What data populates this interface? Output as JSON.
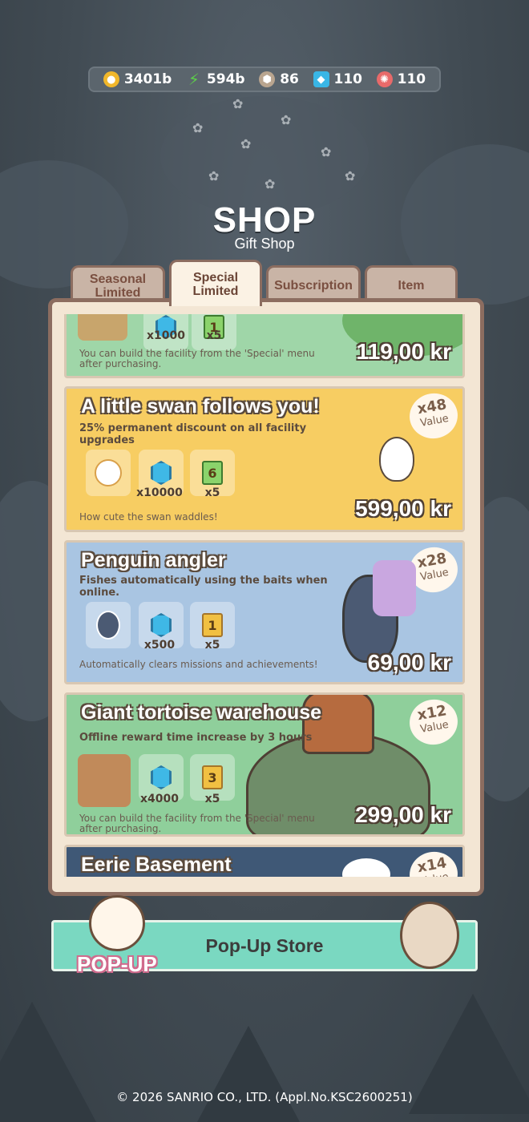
{
  "resources": [
    {
      "icon": "gold-coin-icon",
      "value": "3401b",
      "color": "#f1b72a"
    },
    {
      "icon": "energy-bolt-icon",
      "value": "594b",
      "color": "#5ccf4a"
    },
    {
      "icon": "nut-bolt-icon",
      "value": "86",
      "color": "#b9a58f"
    },
    {
      "icon": "blue-gem-icon",
      "value": "110",
      "color": "#39b6e6"
    },
    {
      "icon": "red-gem-icon",
      "value": "110",
      "color": "#e86a6a"
    }
  ],
  "header": {
    "title": "SHOP",
    "subtitle": "Gift Shop"
  },
  "tabs": [
    {
      "label": "Seasonal Limited"
    },
    {
      "label": "Special Limited"
    },
    {
      "label": "Subscription"
    },
    {
      "label": "Item"
    }
  ],
  "packages": [
    {
      "name": "",
      "description": "",
      "items": [
        {
          "qty": "x1000"
        },
        {
          "qty": "x5"
        }
      ],
      "footer": "You can build the facility from the 'Special' menu after purchasing.",
      "price": "119,00 kr",
      "bg": "#9fd6a8"
    },
    {
      "name": "A little swan follows you!",
      "description": "25% permanent discount on all facility upgrades",
      "items": [
        {
          "qty": ""
        },
        {
          "qty": "x10000"
        },
        {
          "qty": "x5",
          "ticket": "6"
        }
      ],
      "footer": "How cute the swan waddles!",
      "value_badge": {
        "multiplier": "x48",
        "label": "Value"
      },
      "price": "599,00 kr",
      "bg": "#f7cd62"
    },
    {
      "name": "Penguin angler",
      "description": "Fishes automatically using the baits when online.",
      "items": [
        {
          "qty": ""
        },
        {
          "qty": "x500"
        },
        {
          "qty": "x5",
          "ticket": "1"
        }
      ],
      "footer": "Automatically clears missions and achievements!",
      "value_badge": {
        "multiplier": "x28",
        "label": "Value"
      },
      "price": "69,00 kr",
      "bg": "#a9c5e2"
    },
    {
      "name": "Giant tortoise warehouse",
      "description": "Offline reward time increase by 3 hours",
      "items": [
        {
          "qty": ""
        },
        {
          "qty": "x4000"
        },
        {
          "qty": "x5",
          "ticket": "3"
        }
      ],
      "footer": "You can build the facility from the 'Special' menu after purchasing.",
      "value_badge": {
        "multiplier": "x12",
        "label": "Value"
      },
      "price": "299,00 kr",
      "bg": "#8fcf9b"
    },
    {
      "name": "Eerie Basement",
      "value_badge": {
        "multiplier": "x14",
        "label": "Value"
      },
      "bg": "#3f5876"
    }
  ],
  "popup": {
    "label": "POP-UP",
    "title": "Pop-Up Store"
  },
  "copyright": "© 2026 SANRIO CO., LTD. (Appl.No.KSC2600251)"
}
